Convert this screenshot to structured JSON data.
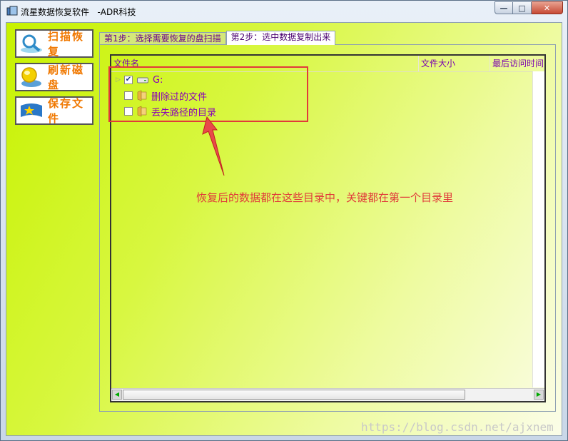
{
  "window": {
    "title": "流星数据恢复软件   -ADR科技",
    "buttons": {
      "minimize": "—",
      "maximize": "□",
      "close": "✕"
    }
  },
  "sidebar": {
    "buttons": [
      {
        "label": "扫描恢复",
        "icon": "scan-magnifier-icon"
      },
      {
        "label": "刷新磁盘",
        "icon": "refresh-disk-icon"
      },
      {
        "label": "保存文件",
        "icon": "save-file-icon"
      }
    ]
  },
  "tabs": [
    {
      "label": "第1步：选择需要恢复的盘扫描",
      "active": false
    },
    {
      "label": "第2步：选中数据复制出来",
      "active": true
    }
  ],
  "list": {
    "columns": [
      "文件名",
      "文件大小",
      "最后访问时间"
    ],
    "rows": [
      {
        "expander": "▷",
        "checked": true,
        "icon": "drive-icon",
        "name": "G:"
      },
      {
        "expander": "",
        "checked": false,
        "icon": "folder-icon",
        "name": "删除过的文件"
      },
      {
        "expander": "",
        "checked": false,
        "icon": "folder-icon",
        "name": "丢失路径的目录"
      }
    ]
  },
  "annotation": {
    "text": "恢复后的数据都在这些目录中，关键都在第一个目录里",
    "color": "#e03a3a"
  },
  "watermark": "https://blog.csdn.net/ajxnem",
  "colors": {
    "accent_purple": "#8a00b8",
    "button_text": "#f07800",
    "client_bg_start": "#c7f200"
  }
}
